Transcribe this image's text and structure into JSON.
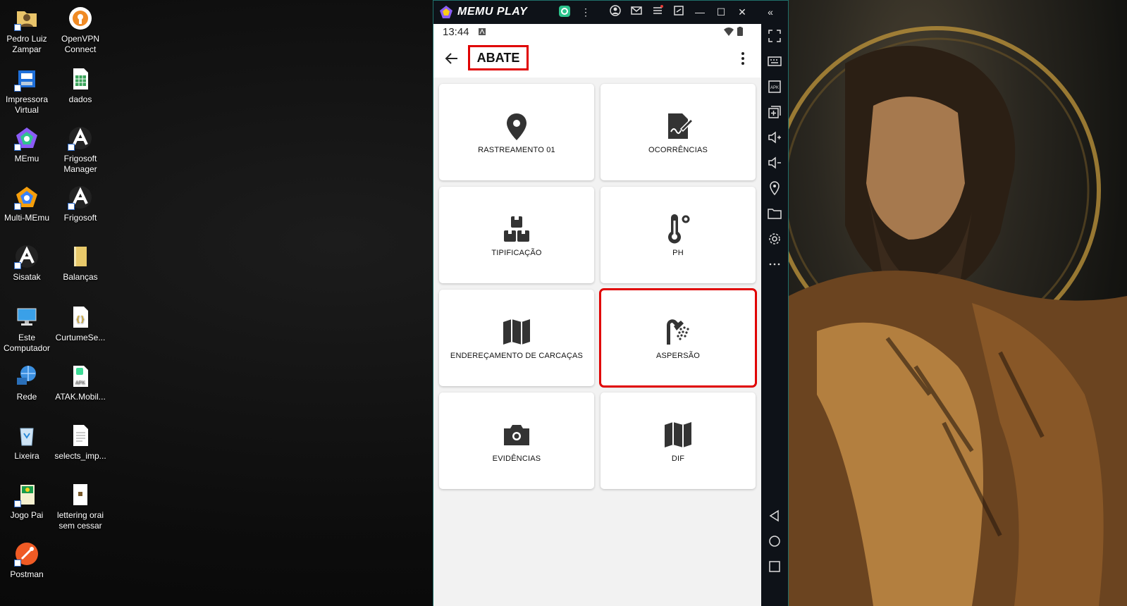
{
  "desktop": {
    "icons": [
      {
        "label": "Pedro Luiz Zampar",
        "icon": "user-folder-icon"
      },
      {
        "label": "OpenVPN Connect",
        "icon": "openvpn-icon"
      },
      {
        "label": "Impressora Virtual",
        "icon": "printer-icon"
      },
      {
        "label": "dados",
        "icon": "spreadsheet-icon"
      },
      {
        "label": "MEmu",
        "icon": "memu-icon"
      },
      {
        "label": "Frigosoft Manager",
        "icon": "frigosoft-icon"
      },
      {
        "label": "Multi-MEmu",
        "icon": "multi-memu-icon"
      },
      {
        "label": "Frigosoft",
        "icon": "frigosoft-icon"
      },
      {
        "label": "Sisatak",
        "icon": "sisatak-icon"
      },
      {
        "label": "Balanças",
        "icon": "folder-icon"
      },
      {
        "label": "Este Computador",
        "icon": "computer-icon"
      },
      {
        "label": "CurtumeSe...",
        "icon": "json-file-icon"
      },
      {
        "label": "Rede",
        "icon": "network-icon"
      },
      {
        "label": "ATAK.Mobil...",
        "icon": "apk-file-icon"
      },
      {
        "label": "Lixeira",
        "icon": "recycle-bin-icon"
      },
      {
        "label": "selects_imp...",
        "icon": "text-file-icon"
      },
      {
        "label": "Jogo Pai",
        "icon": "game-icon"
      },
      {
        "label": "lettering orai sem cessar",
        "icon": "image-file-icon"
      },
      {
        "label": "Postman",
        "icon": "postman-icon"
      }
    ]
  },
  "emulator": {
    "brand": "MEMU PLAY",
    "status": {
      "time": "13:44"
    },
    "appbar": {
      "title": "ABATE"
    },
    "tiles": [
      {
        "label": "RASTREAMENTO 01",
        "icon": "location-pin-icon"
      },
      {
        "label": "OCORRÊNCIAS",
        "icon": "document-edit-icon"
      },
      {
        "label": "TIPIFICAÇÃO",
        "icon": "boxes-icon"
      },
      {
        "label": "PH",
        "icon": "thermometer-icon"
      },
      {
        "label": "ENDEREÇAMENTO DE CARCAÇAS",
        "icon": "map-icon"
      },
      {
        "label": "ASPERSÃO",
        "icon": "shower-icon",
        "highlighted": true
      },
      {
        "label": "EVIDÊNCIAS",
        "icon": "camera-icon"
      },
      {
        "label": "DIF",
        "icon": "map-icon"
      }
    ],
    "highlight_color": "#e00000"
  }
}
